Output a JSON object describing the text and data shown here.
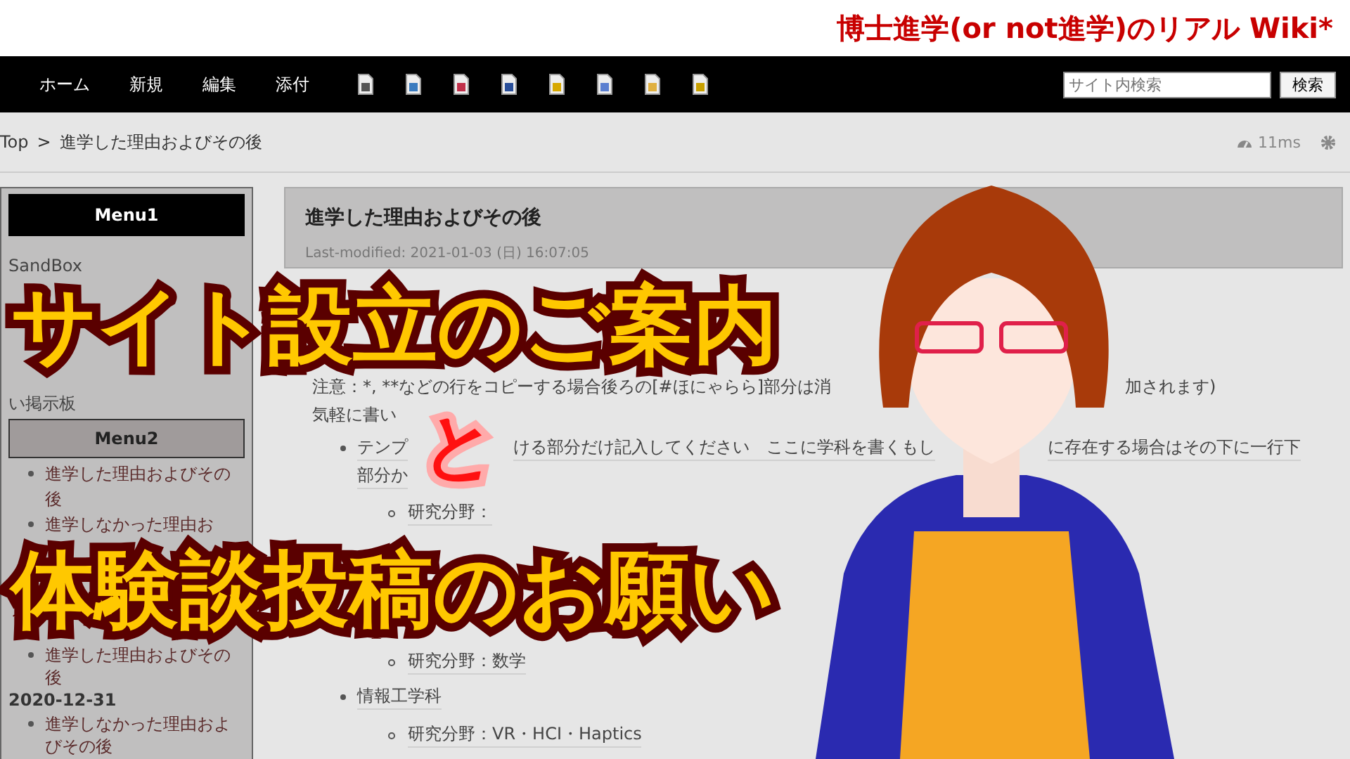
{
  "header": {
    "site_title": "博士進学(or not進学)のリアル Wiki*"
  },
  "nav": {
    "items": [
      "ホーム",
      "新規",
      "編集",
      "添付"
    ],
    "search": {
      "placeholder": "サイト内検索"
    },
    "search_button": "検索"
  },
  "breadcrumb": {
    "root": "Top",
    "separator": ">",
    "current": "進学した理由およびその後",
    "timing": "11ms"
  },
  "sidebar": {
    "menu1": {
      "title": "Menu1",
      "items": [
        "SandBox",
        "い掲示板"
      ]
    },
    "menu2": {
      "title": "Menu2",
      "items": [
        "進学した理由およびその後",
        "進学しなかった理由お"
      ]
    },
    "recent": {
      "items_before": [
        "進学した理由およびその後"
      ],
      "date": "2020-12-31",
      "items_after": [
        "進学しなかった理由およびその後"
      ]
    }
  },
  "main": {
    "title": "進学した理由およびその後",
    "last_modified": "Last-modified: 2021-01-03 (日) 16:07:05",
    "lines": [
      {
        "kind": "para",
        "segments": [
          "注意：*, **などの行をコピーする場合後ろの[#ほにゃらら]部分は消",
          "加されます)"
        ]
      },
      {
        "kind": "para",
        "segments": [
          "気軽に書い"
        ]
      },
      {
        "kind": "bullet",
        "segments": [
          "テンプ",
          "ける部分だけ記入してください　ここに学科を書くもし",
          "に存在する場合はその下に一行下"
        ]
      },
      {
        "kind": "cont",
        "segments": [
          "部分か"
        ]
      },
      {
        "kind": "sub",
        "segments": [
          "研究分野："
        ]
      },
      {
        "kind": "sub",
        "segments": [
          "研究分野：数学"
        ]
      },
      {
        "kind": "bullet",
        "segments": [
          "情報工学科"
        ]
      },
      {
        "kind": "sub",
        "segments": [
          "研究分野：VR・HCI・Haptics"
        ]
      }
    ]
  },
  "overlay": {
    "captions": [
      {
        "kind": "headline",
        "text": "サイト設立のご案内"
      },
      {
        "kind": "connector",
        "text": "と"
      },
      {
        "kind": "headline",
        "text": "体験談投稿のお願い"
      }
    ]
  }
}
